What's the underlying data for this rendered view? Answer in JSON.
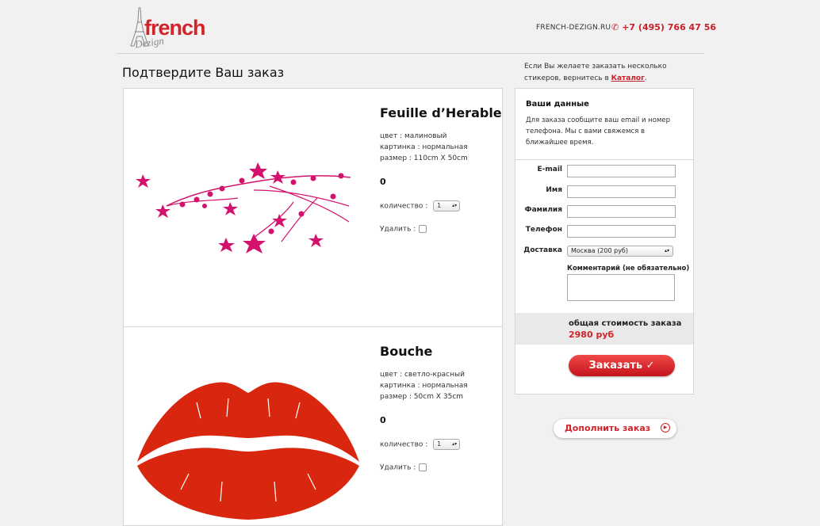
{
  "header": {
    "logo_text": "french",
    "logo_sub": "Dezign",
    "site_link": "FRENCH-DEZIGN.RU",
    "phone": "+7 (495) 766 47 56"
  },
  "page_title": "Подтвердите Ваш заказ",
  "hint": {
    "text_before": "Если Вы желаете заказать несколько стикеров, вернитесь в ",
    "link": "Каталог",
    "text_after": "."
  },
  "products": [
    {
      "name": "Feuille d’Herable",
      "color_line": "цвет : малиновый",
      "picture_line": "картинка : нормальная",
      "size_line": "размер : 110cm X 50cm",
      "price": "0",
      "qty_label": "количество :",
      "qty_value": "1",
      "delete_label": "Удалить :"
    },
    {
      "name": "Bouche",
      "color_line": "цвет : светло-красный",
      "picture_line": "картинка : нормальная",
      "size_line": "размер : 50cm X 35cm",
      "price": "0",
      "qty_label": "количество :",
      "qty_value": "1",
      "delete_label": "Удалить :"
    }
  ],
  "form": {
    "title": "Ваши данные",
    "description": "Для заказа сообщите ваш email и номер телефона. Мы с вами свяжемся в ближайшее время.",
    "email_label": "E-mail",
    "name_label": "Имя",
    "surname_label": "Фамилия",
    "phone_label": "Телефон",
    "delivery_label": "Доставка",
    "delivery_value": "Москва (200 руб)",
    "comment_label": "Комментарий (не обязательно)",
    "total_label": "общая стоимость заказа",
    "total_value": "2980 руб",
    "order_button": "Заказать ✓"
  },
  "more_button": "Дополнить заказ",
  "colors": {
    "accent": "#d2232a",
    "leaf_sticker": "#d4126e",
    "lips_sticker": "#d9260e"
  }
}
